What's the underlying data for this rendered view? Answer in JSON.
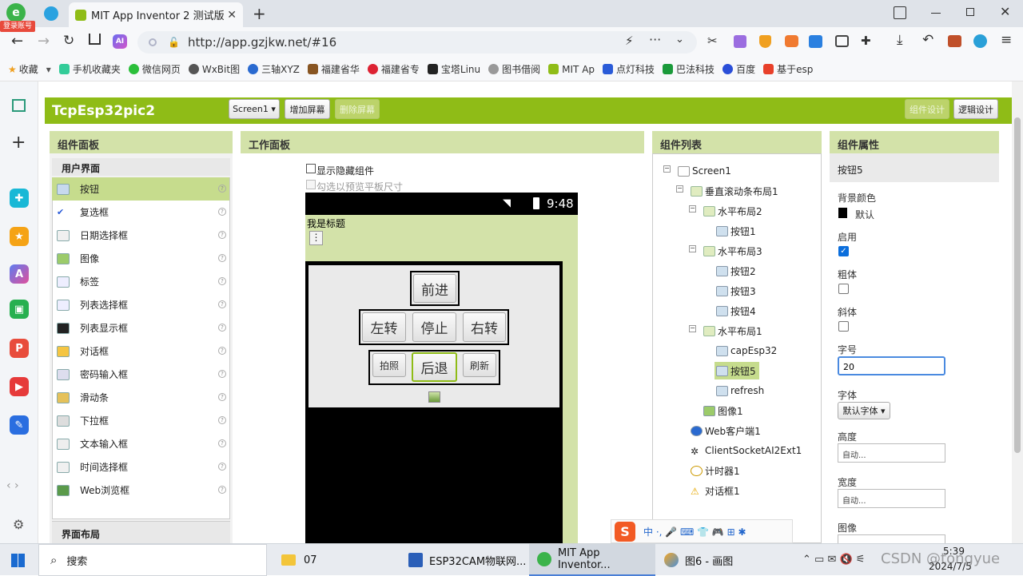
{
  "browser": {
    "login_badge": "登录账号",
    "tab_title": "MIT App Inventor 2 测试版",
    "new_tab": "+",
    "url": "http://app.gzjkw.net/#16",
    "bookmarks": [
      "收藏",
      "手机收藏夹",
      "微信网页",
      "WxBit图",
      "三轴XYZ",
      "福建省华",
      "福建省专",
      "宝塔Linu",
      "图书借阅",
      "MIT Ap",
      "点灯科技",
      "巴法科技",
      "百度",
      "基于esp"
    ]
  },
  "app": {
    "project_title": "TcpEsp32pic2",
    "screen_dropdown": "Screen1 ▾",
    "add_screen": "增加屏幕",
    "delete_screen": "删除屏幕",
    "designer": "组件设计",
    "blocks": "逻辑设计"
  },
  "palette": {
    "title": "组件面板",
    "category": "用户界面",
    "items": [
      "按钮",
      "复选框",
      "日期选择框",
      "图像",
      "标签",
      "列表选择框",
      "列表显示框",
      "对话框",
      "密码输入框",
      "滑动条",
      "下拉框",
      "文本输入框",
      "时间选择框",
      "Web浏览框"
    ],
    "help": "?",
    "next_category": "界面布局"
  },
  "viewer": {
    "title": "工作面板",
    "show_hidden": "显示隐藏组件",
    "preview_tablet": "勾选以预览平板尺寸",
    "time": "9:48",
    "screen_title": "我是标题",
    "menu": "⋮",
    "buttons": {
      "forward": "前进",
      "left": "左转",
      "stop": "停止",
      "right": "右转",
      "photo": "拍照",
      "back": "后退",
      "refresh": "刷新"
    }
  },
  "components": {
    "title": "组件列表",
    "tree": [
      {
        "label": "Screen1",
        "depth": 0,
        "toggle": "−",
        "kind": "scr"
      },
      {
        "label": "垂直滚动条布局1",
        "depth": 1,
        "toggle": "−",
        "kind": "lay"
      },
      {
        "label": "水平布局2",
        "depth": 2,
        "toggle": "−",
        "kind": "lay"
      },
      {
        "label": "按钮1",
        "depth": 3,
        "toggle": "",
        "kind": "btn"
      },
      {
        "label": "水平布局3",
        "depth": 2,
        "toggle": "−",
        "kind": "lay"
      },
      {
        "label": "按钮2",
        "depth": 3,
        "toggle": "",
        "kind": "btn"
      },
      {
        "label": "按钮3",
        "depth": 3,
        "toggle": "",
        "kind": "btn"
      },
      {
        "label": "按钮4",
        "depth": 3,
        "toggle": "",
        "kind": "btn"
      },
      {
        "label": "水平布局1",
        "depth": 2,
        "toggle": "−",
        "kind": "lay"
      },
      {
        "label": "capEsp32",
        "depth": 3,
        "toggle": "",
        "kind": "btn"
      },
      {
        "label": "按钮5",
        "depth": 3,
        "toggle": "",
        "kind": "btn",
        "selected": true
      },
      {
        "label": "refresh",
        "depth": 3,
        "toggle": "",
        "kind": "btn"
      },
      {
        "label": "图像1",
        "depth": 2,
        "toggle": "",
        "kind": "img"
      },
      {
        "label": "Web客户端1",
        "depth": 1,
        "toggle": "",
        "kind": "web"
      },
      {
        "label": "ClientSocketAI2Ext1",
        "depth": 1,
        "toggle": "",
        "kind": "ext"
      },
      {
        "label": "计时器1",
        "depth": 1,
        "toggle": "",
        "kind": "clock"
      },
      {
        "label": "对话框1",
        "depth": 1,
        "toggle": "",
        "kind": "warn"
      }
    ]
  },
  "properties": {
    "title": "组件属性",
    "component": "按钮5",
    "bg_color_label": "背景颜色",
    "bg_color_value": "默认",
    "enabled_label": "启用",
    "enabled": true,
    "bold_label": "粗体",
    "bold": false,
    "italic_label": "斜体",
    "italic": false,
    "fontsize_label": "字号",
    "fontsize_value": "20",
    "font_label": "字体",
    "font_value": "默认字体 ▾",
    "height_label": "高度",
    "height_value": "自动...",
    "width_label": "宽度",
    "width_value": "自动...",
    "image_label": "图像"
  },
  "taskbar": {
    "search": "搜索",
    "tasks": [
      "07",
      "ESP32CAM物联网...",
      "MIT App Inventor...",
      "图6 - 画图"
    ],
    "time": "5:39",
    "date": "2024/7/5",
    "watermark": "CSDN @tongyue"
  },
  "colors": {
    "accent": "#8fbc17",
    "panel_head": "#d3e2a9",
    "selected": "#c6dc8d"
  }
}
